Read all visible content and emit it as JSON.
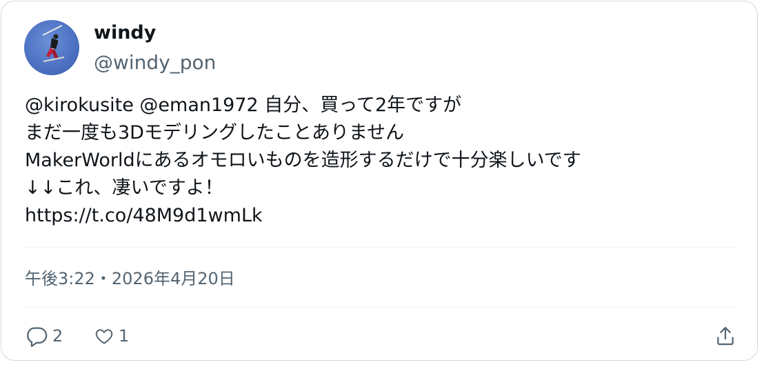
{
  "author": {
    "display_name": "windy",
    "handle": "@windy_pon"
  },
  "tweet": {
    "lines": [
      "@kirokusite @eman1972 自分、買って2年ですが",
      "まだ一度も3Dモデリングしたことありません",
      "MakerWorldにあるオモロいものを造形するだけで十分楽しいです",
      "↓↓これ、凄いですよ！",
      "https://t.co/48M9d1wmLk"
    ],
    "timestamp": "午後3:22・2026年4月20日"
  },
  "actions": {
    "reply_count": "2",
    "like_count": "1",
    "reply_icon": "reply-icon",
    "like_icon": "heart-icon",
    "share_icon": "share-icon"
  },
  "colors": {
    "text_primary": "#0f1419",
    "text_secondary": "#536471",
    "border": "#cfd9de",
    "divider": "#eff3f4",
    "avatar_bg": "#4e73c4"
  }
}
